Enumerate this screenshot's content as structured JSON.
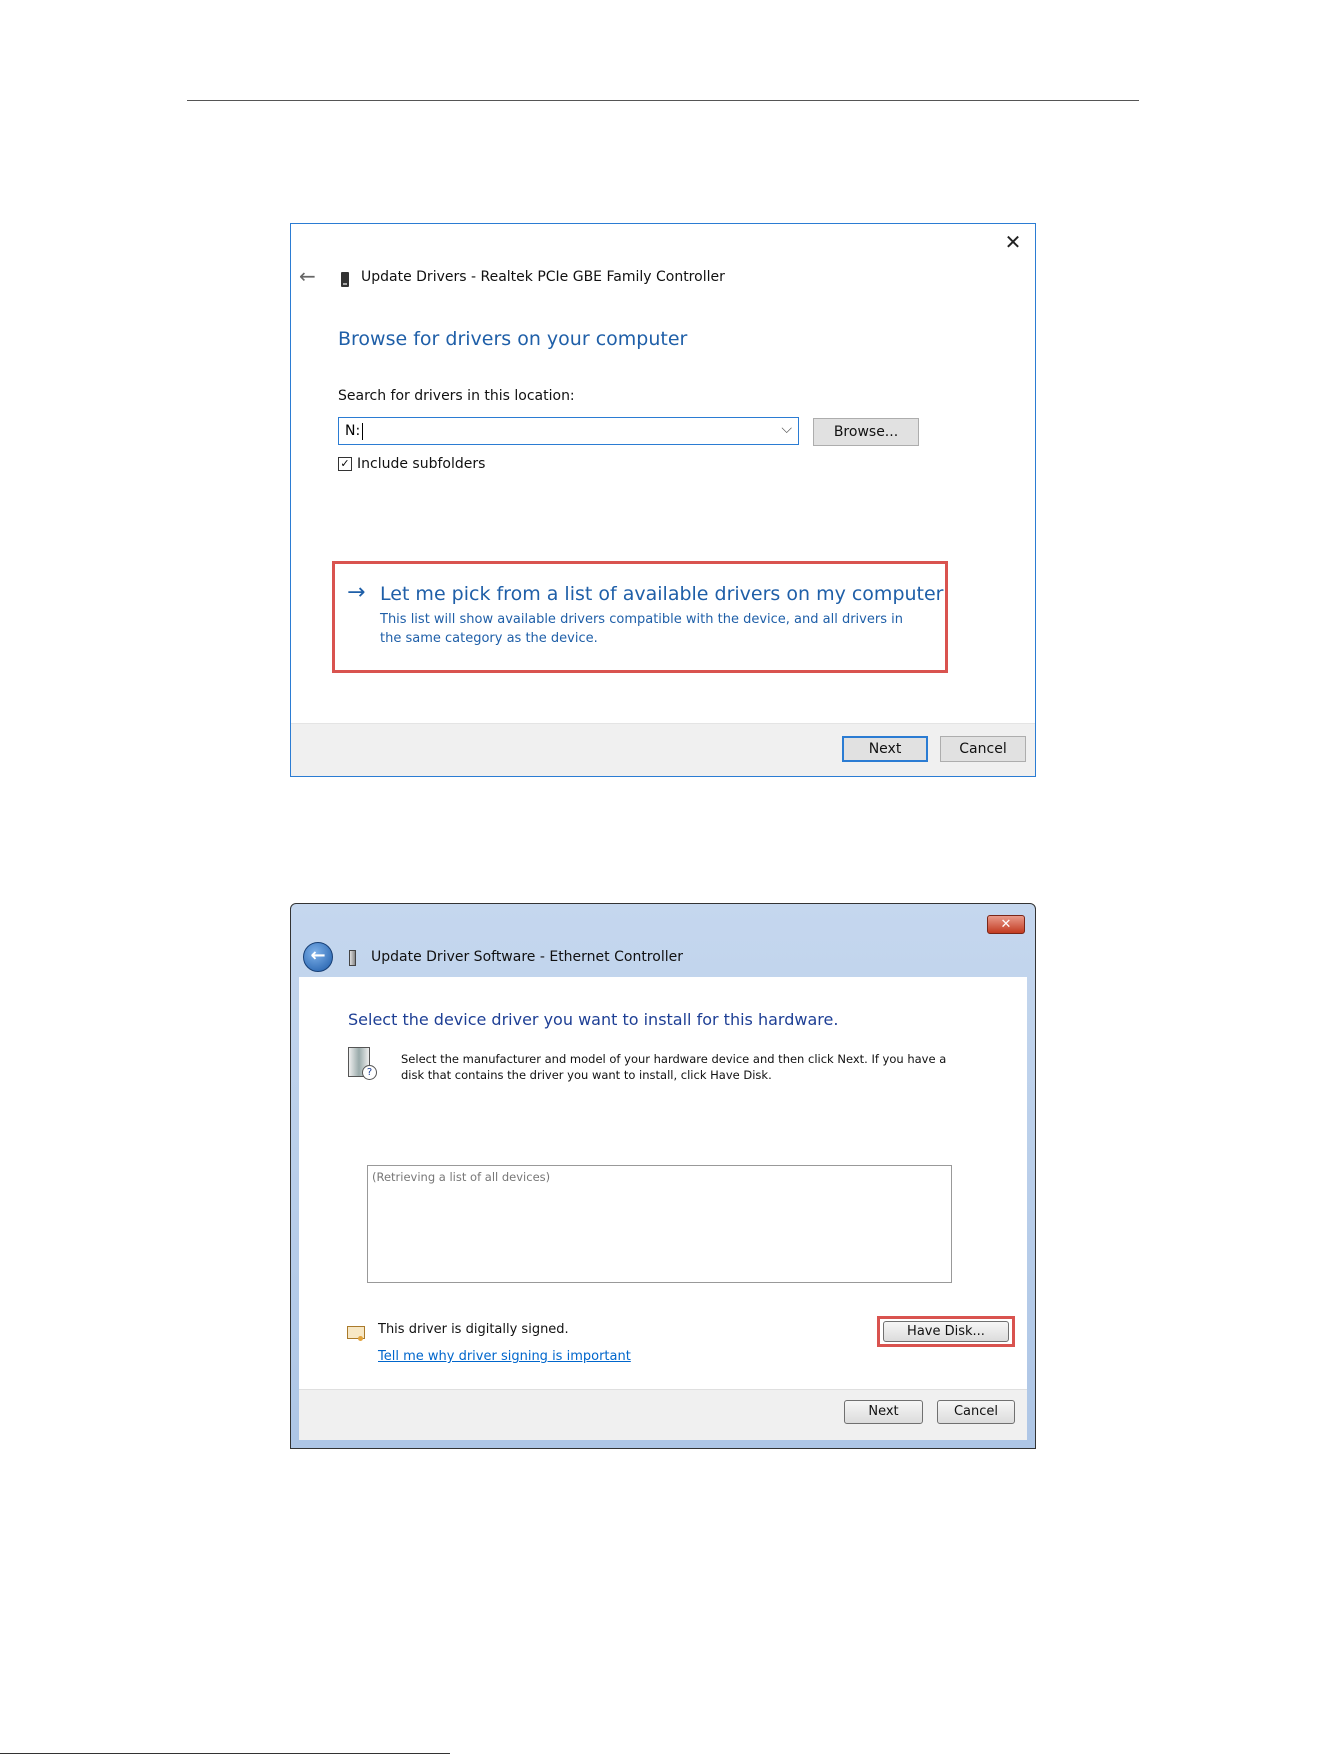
{
  "dialog_win10": {
    "title": "Update Drivers - Realtek PCIe GBE Family Controller",
    "heading": "Browse for drivers on your computer",
    "location_label": "Search for drivers in this location:",
    "location_value": "N:",
    "browse_label": "Browse...",
    "include_subfolders_label": "Include subfolders",
    "include_subfolders_checked": true,
    "pick_title": "Let me pick from a list of available drivers on my computer",
    "pick_description": "This list will show available drivers compatible with the device, and all drivers in the same category as the device.",
    "next_label": "Next",
    "cancel_label": "Cancel",
    "close_glyph": "✕",
    "back_glyph": "←",
    "pick_arrow_glyph": "→",
    "highlight_color": "#d9534f",
    "accent_color": "#1f5fa8"
  },
  "dialog_win7": {
    "title": "Update Driver Software -  Ethernet Controller",
    "heading": "Select the device driver you want to install for this hardware.",
    "instructions": "Select the manufacturer and model of your hardware device and then click Next. If you have a disk that contains the driver you want to install, click Have Disk.",
    "list_placeholder": "(Retrieving a list of all devices)",
    "signed_text": "This driver is digitally signed.",
    "signing_link": "Tell me why driver signing is important",
    "have_disk_label": "Have Disk...",
    "next_label": "Next",
    "cancel_label": "Cancel",
    "close_glyph": "✕",
    "back_glyph": "←",
    "help_glyph": "?",
    "highlight_color": "#d9534f"
  }
}
